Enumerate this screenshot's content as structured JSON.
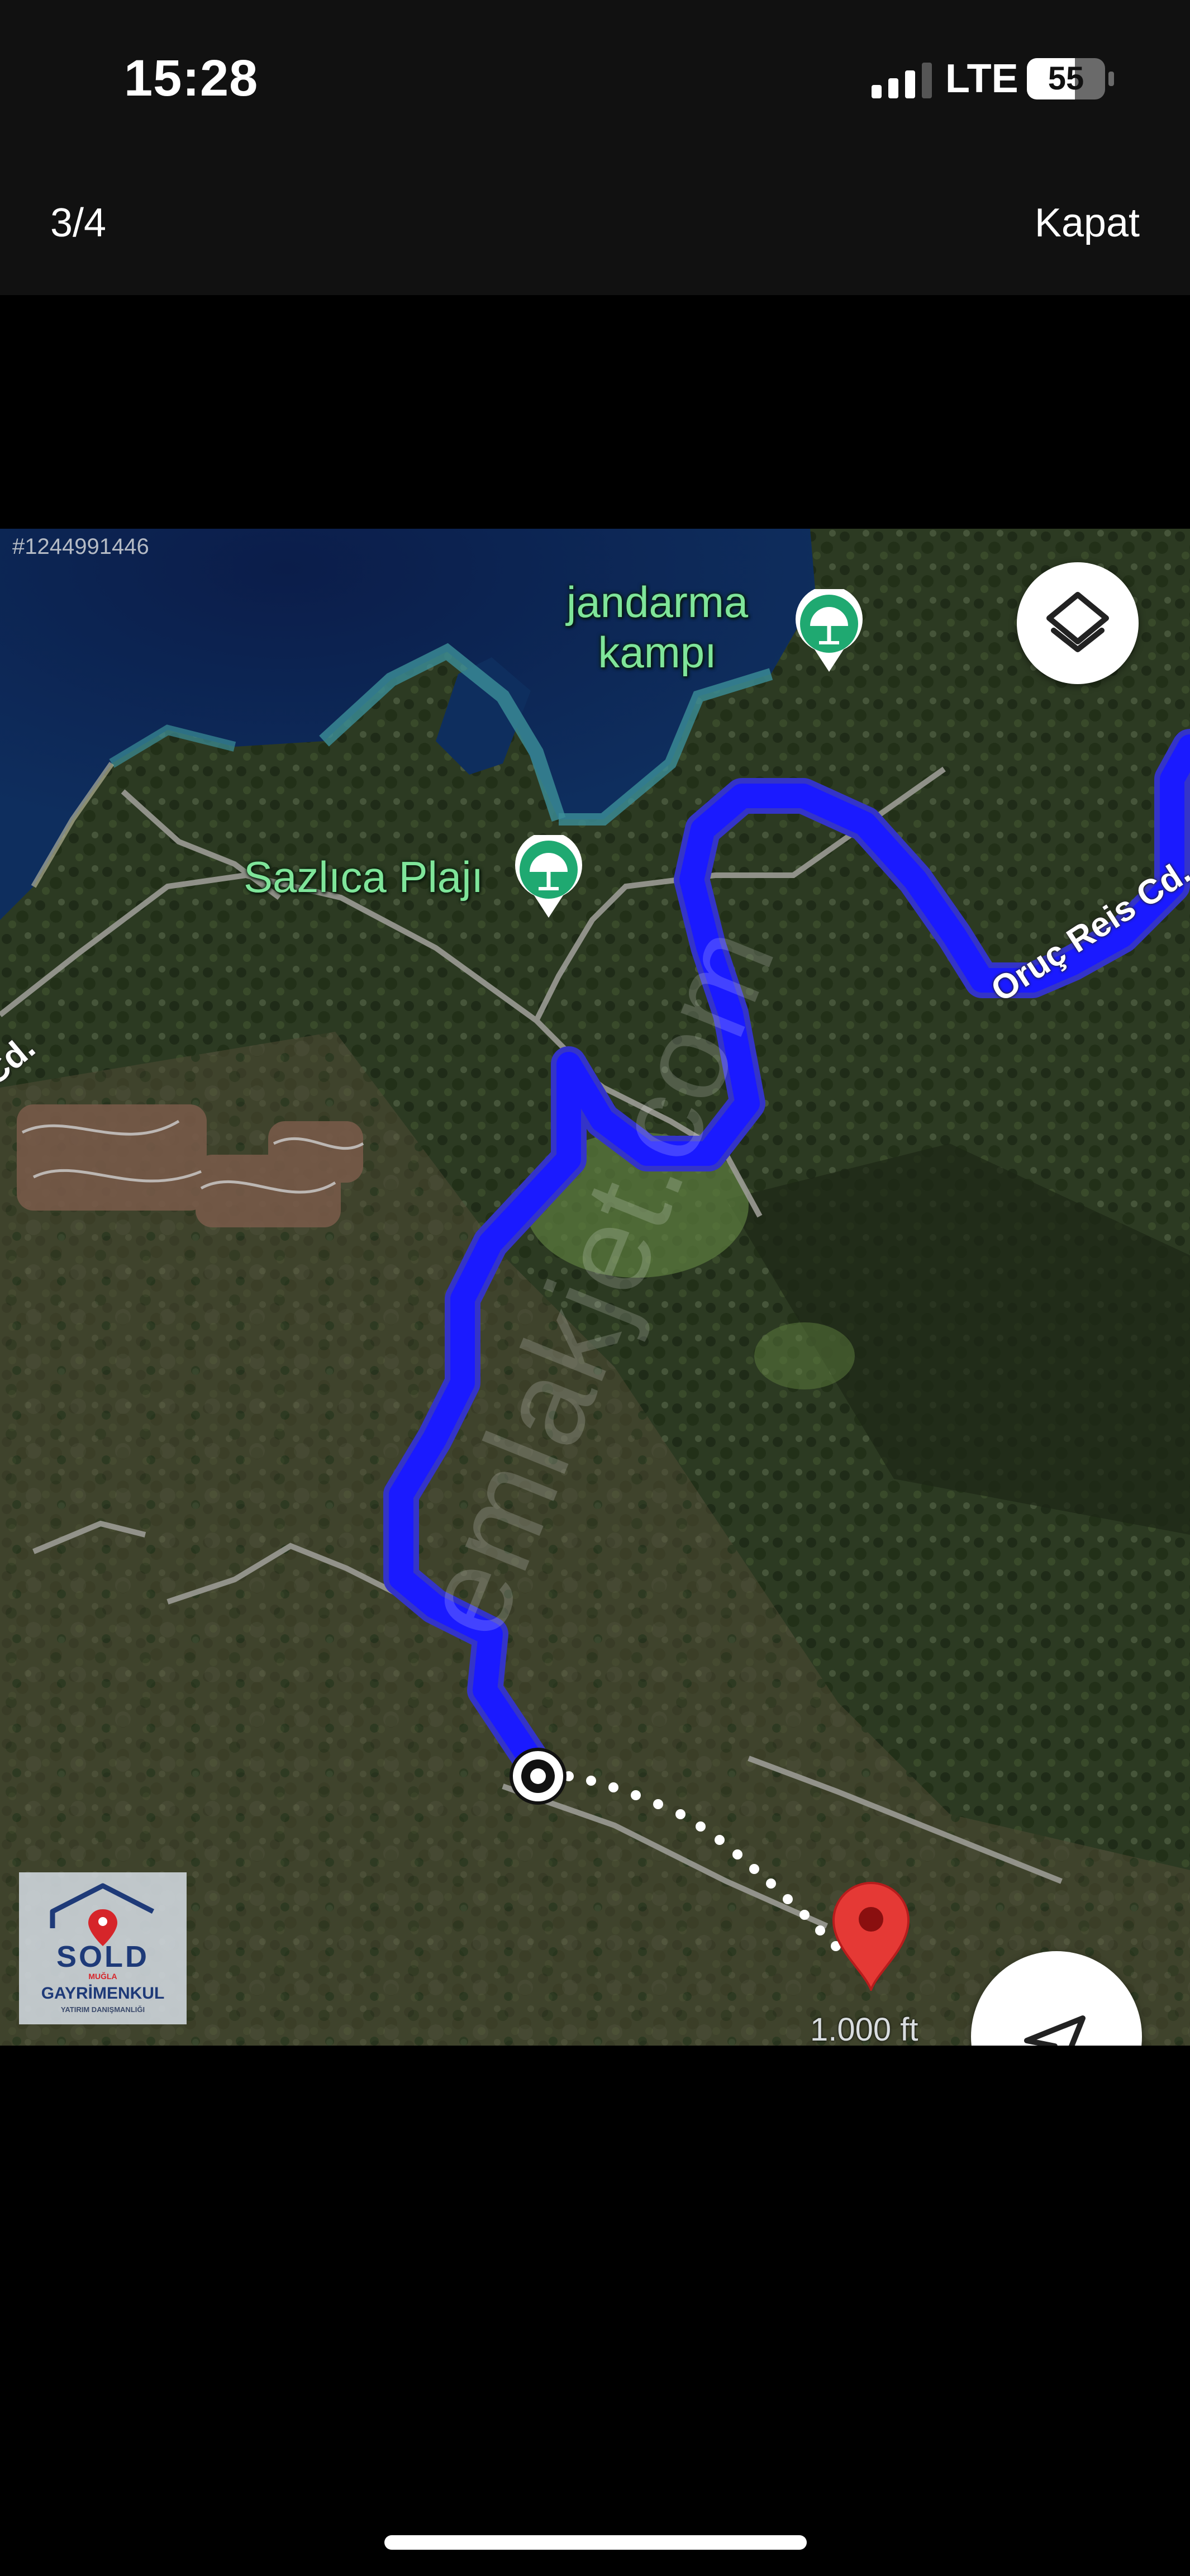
{
  "status_bar": {
    "time": "15:28",
    "network": "LTE",
    "battery": "55",
    "signal_bars": 3,
    "signal_total": 4
  },
  "viewer": {
    "counter": "3/4",
    "close_label": "Kapat"
  },
  "map": {
    "image_id": "#1244991446",
    "places": [
      {
        "name": "jandarma",
        "name_line2": "kampı",
        "icon": "beach-umbrella-icon"
      },
      {
        "name": "Sazlıca Plajı",
        "icon": "beach-umbrella-icon"
      }
    ],
    "roads": [
      {
        "name": "Oruç Reis Cd."
      },
      {
        "name": "Cd."
      }
    ],
    "scale_label": "1.000 ft",
    "watermark": "emlakjet.com",
    "route_color": "#1a1aff",
    "poi_color": "#1fa971",
    "pin_color": "#e53935",
    "buttons": {
      "layers_icon": "layers-icon",
      "locate_icon": "navigation-arrow-icon"
    }
  },
  "logo": {
    "brand": "SOLD",
    "subbrand": "MUĞLA",
    "line1": "GAYRİMENKUL",
    "line2": "YATIRIM DANIŞMANLIĞI"
  }
}
